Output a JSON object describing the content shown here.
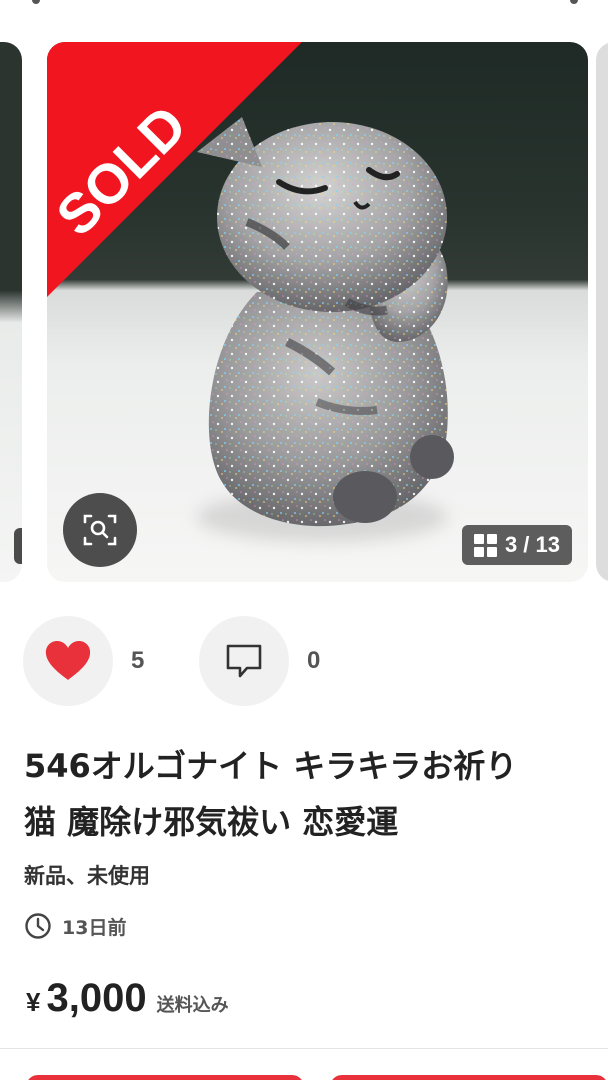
{
  "product": {
    "sold_label": "SOLD",
    "image_counter": "3 / 13",
    "likes": "5",
    "comments": "0",
    "title": "546オルゴナイト キラキラお祈り\n猫 魔除け邪気祓い 恋愛運",
    "condition": "新品、未使用",
    "posted": "13日前",
    "price_symbol": "¥",
    "price": "3,000",
    "price_note": "送料込み"
  },
  "colors": {
    "sold_red": "#f0151f",
    "heart_red": "#e8313a",
    "bottom_button_red": "#e8313a"
  },
  "icons": [
    "zoom-icon",
    "grid-icon",
    "heart-icon",
    "comment-icon",
    "clock-icon"
  ]
}
